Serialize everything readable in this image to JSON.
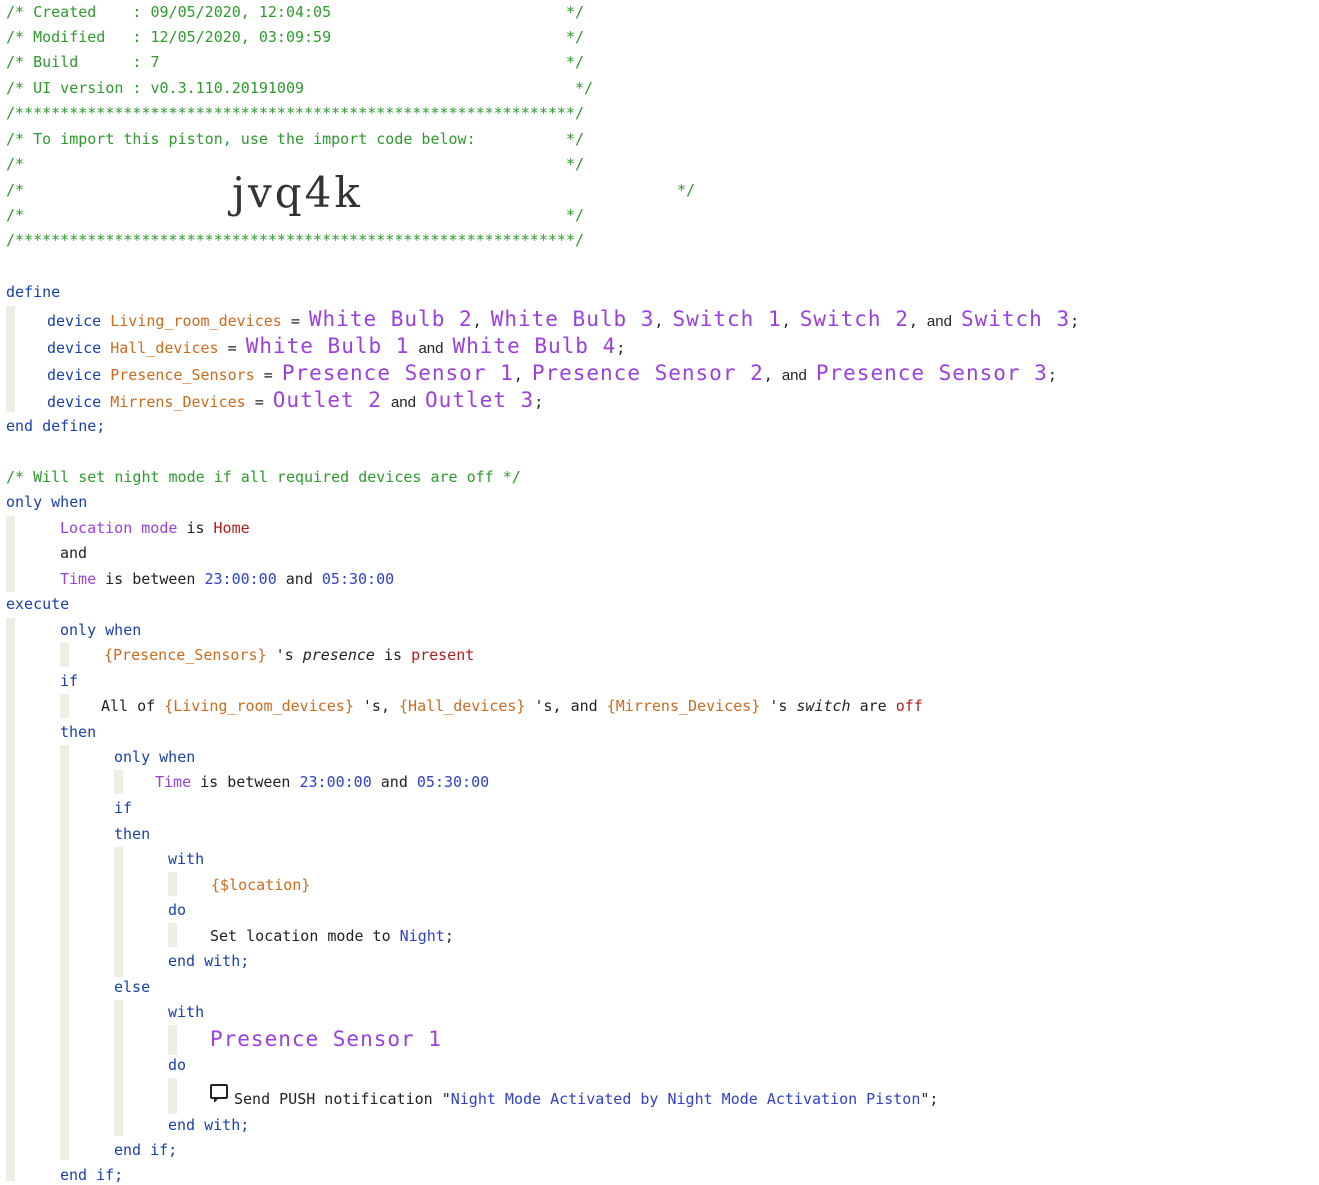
{
  "header": {
    "created_line": "/* Created    : 09/05/2020, 12:04:05                          */",
    "modified_line": "/* Modified   : 12/05/2020, 03:09:59                          */",
    "build_line": "/* Build      : 7                                             */",
    "ui_line": "/* UI version : v0.3.110.20191009                              */",
    "stars_top": "/**************************************************************/",
    "import_line": "/* To import this piston, use the import code below:          */",
    "blank1": "/*                                                            */",
    "code_left": "/*",
    "code_right": "*/",
    "import_code": "jvq4k",
    "blank2": "/*                                                            */",
    "stars_bottom": "/**************************************************************/"
  },
  "define": {
    "start": "define",
    "end": "end define;",
    "device_kw": "device",
    "eq": "=",
    "and": "and",
    "comma": ",",
    "semicolon": ";",
    "devices": [
      {
        "name": "Living_room_devices",
        "items": [
          "White Bulb 2",
          "White Bulb 3",
          "Switch 1",
          "Switch 2",
          "Switch 3"
        ]
      },
      {
        "name": "Hall_devices",
        "items": [
          "White Bulb 1",
          "White Bulb 4"
        ]
      },
      {
        "name": "Presence_Sensors",
        "items": [
          "Presence Sensor 1",
          "Presence Sensor 2",
          "Presence Sensor 3"
        ]
      },
      {
        "name": "Mirrens_Devices",
        "items": [
          "Outlet 2",
          "Outlet 3"
        ]
      }
    ]
  },
  "comment": "/* Will set night mode if all required devices are off */",
  "kw": {
    "only": "only",
    "when": "when",
    "and": "and",
    "execute": "execute",
    "if": "if",
    "then": "then",
    "else": "else",
    "with": "with",
    "do": "do",
    "end_with": "end with;",
    "end_if": "end if;"
  },
  "conditions": {
    "location": "Location",
    "mode": "mode",
    "is": "is",
    "home": "Home",
    "time": "Time",
    "is_between": "is between",
    "start_time": "23:00:00",
    "end_time": "05:30:00",
    "presence_var": "{Presence_Sensors}",
    "apos_s": "'s",
    "presence": "presence",
    "present": "present",
    "all_of": "All of",
    "living_var": "{Living_room_devices}",
    "hall_var": "{Hall_devices}",
    "mirrens_var": "{Mirrens_Devices}",
    "apos_s_comma": "'s,",
    "switch": "switch",
    "are": "are",
    "off": "off"
  },
  "actions": {
    "location_var": "{$location}",
    "set_mode": "Set location mode to",
    "night": "Night",
    "with_device": "Presence Sensor 1",
    "send_push": "Send PUSH notification",
    "message": "Night Mode Activated by Night Mode Activation Piston",
    "quote": "\"",
    "end_quote": "\";"
  }
}
